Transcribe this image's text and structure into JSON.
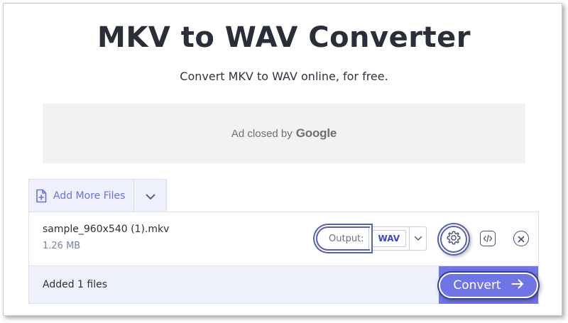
{
  "header": {
    "title": "MKV to WAV Converter",
    "subtitle": "Convert MKV to WAV online, for free."
  },
  "ad": {
    "text": "Ad closed by",
    "brand": "Google"
  },
  "toolbar": {
    "add_more_label": "Add More Files",
    "add_icon": "file-plus-icon",
    "dropdown_icon": "chevron-down-icon"
  },
  "file": {
    "name": "sample_960x540 (1).mkv",
    "size": "1.26 MB",
    "output_label": "Output:",
    "output_format": "WAV",
    "settings_icon": "gear-icon",
    "embed_icon": "code-icon",
    "remove_icon": "close-icon"
  },
  "footer": {
    "status": "Added 1 files",
    "convert_label": "Convert",
    "convert_icon": "arrow-right-icon"
  },
  "colors": {
    "accent": "#7075e6",
    "link": "#6b72d6",
    "panel_bg": "#eef0fb",
    "highlight_ring": "#5c5fa9"
  }
}
